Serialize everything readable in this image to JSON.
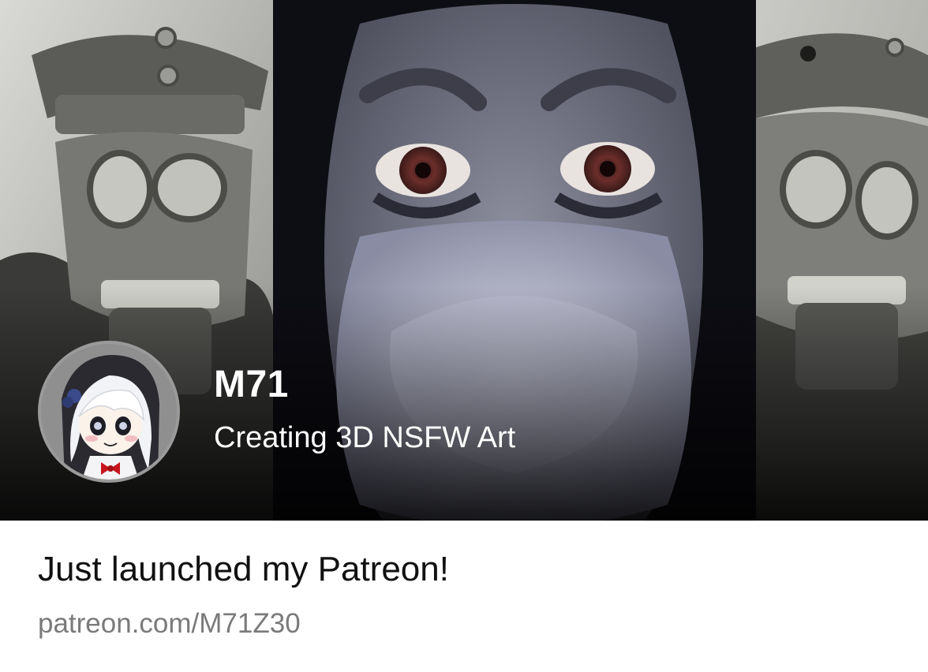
{
  "creator": {
    "name": "M71",
    "tagline": "Creating 3D NSFW Art"
  },
  "post": {
    "title": "Just launched my Patreon!",
    "url": "patreon.com/M71Z30"
  },
  "images": {
    "banner_left": "gas-mask-soldier-photo",
    "banner_center": "donkey-face-closeup",
    "banner_right": "gas-mask-soldier-photo",
    "avatar": "anime-girl-avatar"
  },
  "colors": {
    "title_text": "#111111",
    "url_text": "#7a7a7a",
    "overlay_text": "#ffffff",
    "background": "#ffffff"
  }
}
